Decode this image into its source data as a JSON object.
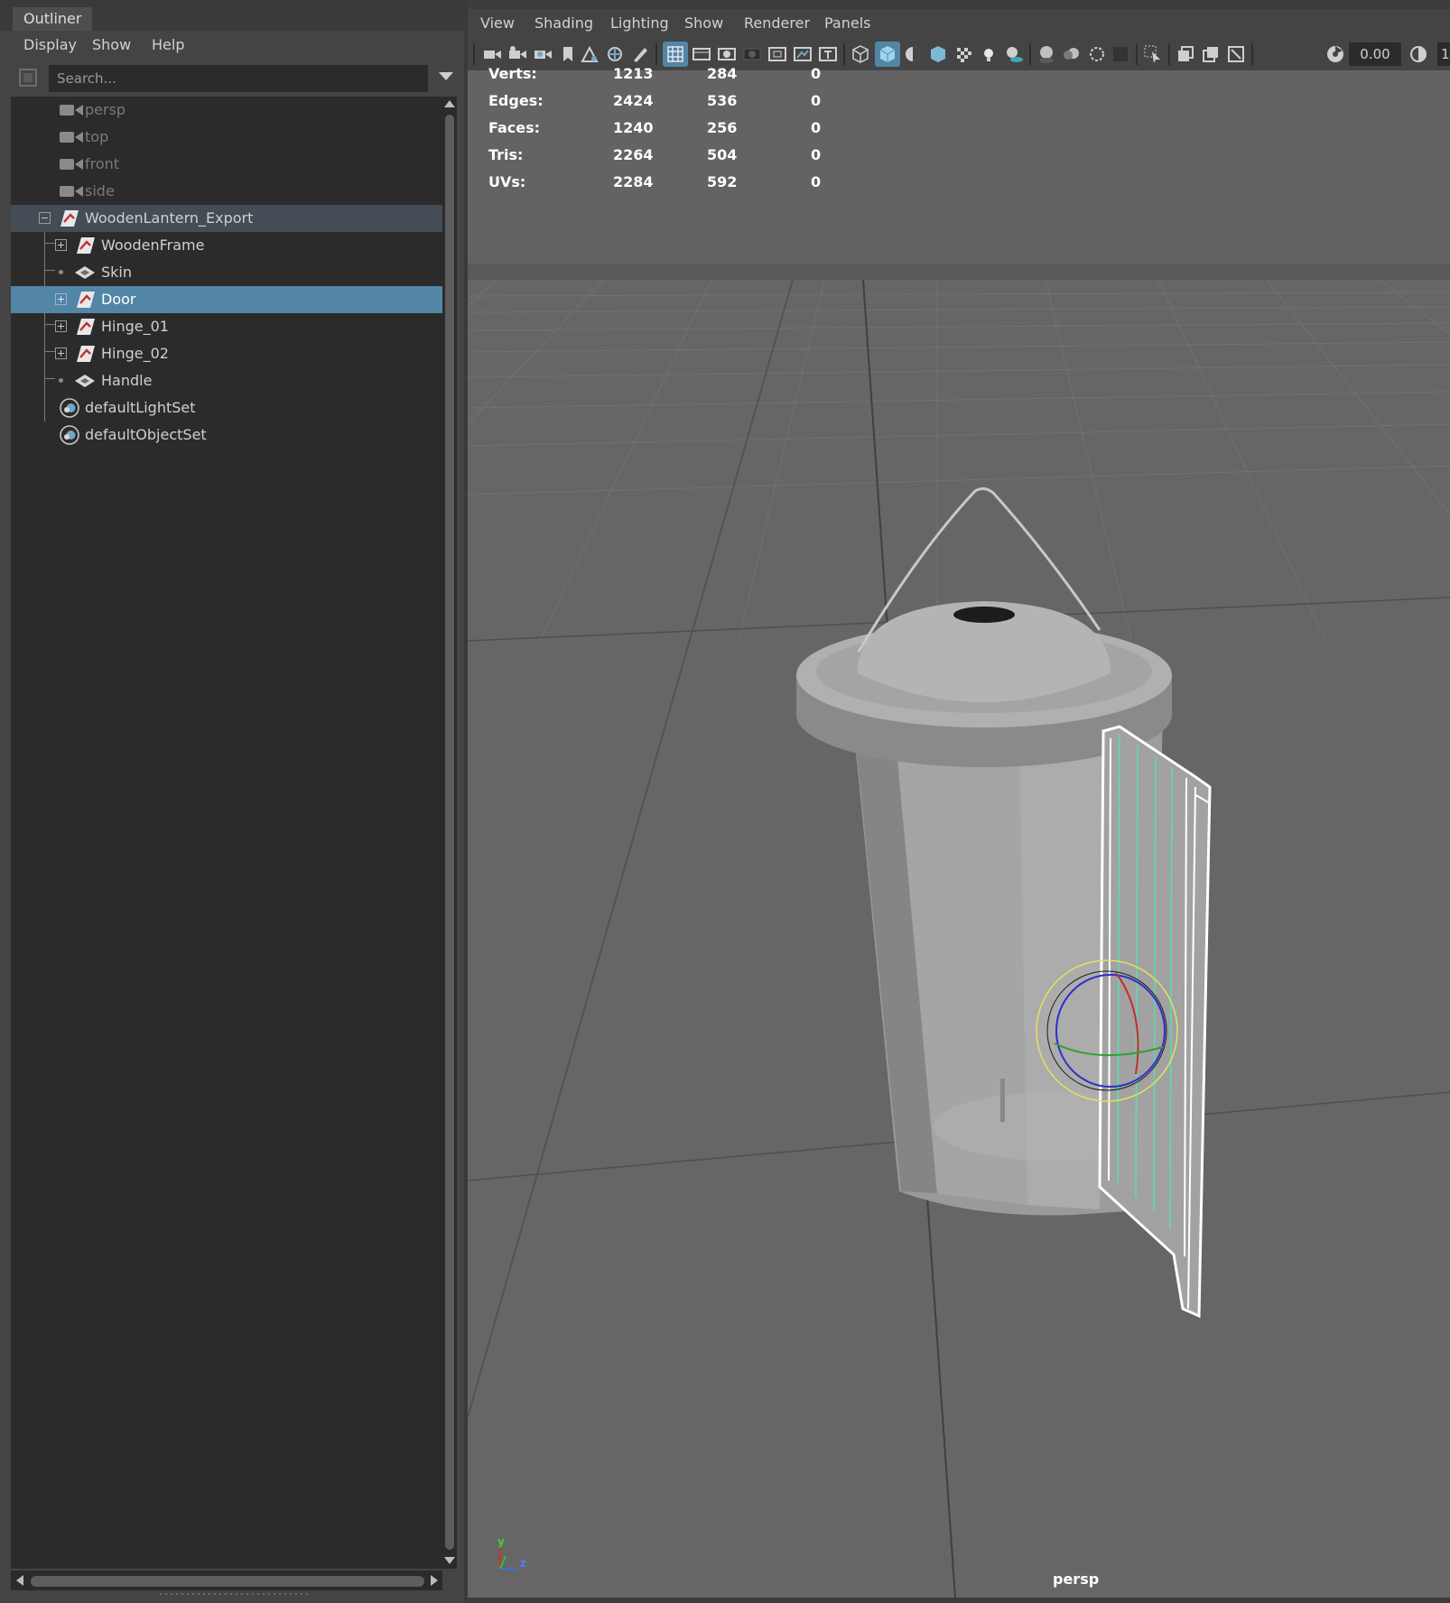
{
  "outliner": {
    "tab_label": "Outliner",
    "menu": [
      "Display",
      "Show",
      "Help"
    ],
    "search_placeholder": "Search...",
    "tree": [
      {
        "label": "persp",
        "type": "camera",
        "dim": true
      },
      {
        "label": "top",
        "type": "camera",
        "dim": true
      },
      {
        "label": "front",
        "type": "camera",
        "dim": true
      },
      {
        "label": "side",
        "type": "camera",
        "dim": true
      },
      {
        "label": "WoodenLantern_Export",
        "type": "transform",
        "expanded": true
      },
      {
        "label": "WoodenFrame",
        "type": "transform",
        "collapsed": true
      },
      {
        "label": "Skin",
        "type": "mesh"
      },
      {
        "label": "Door",
        "type": "transform",
        "collapsed": true,
        "selected": true
      },
      {
        "label": "Hinge_01",
        "type": "transform",
        "collapsed": true
      },
      {
        "label": "Hinge_02",
        "type": "transform",
        "collapsed": true
      },
      {
        "label": "Handle",
        "type": "mesh"
      },
      {
        "label": "defaultLightSet",
        "type": "set"
      },
      {
        "label": "defaultObjectSet",
        "type": "set"
      }
    ]
  },
  "viewport": {
    "menu": [
      "View",
      "Shading",
      "Lighting",
      "Show",
      "Renderer",
      "Panels"
    ],
    "exposure_value": "0.00",
    "gamma_value_partial": "1",
    "camera_name": "persp",
    "axis_labels": {
      "y": "y",
      "z": "z"
    },
    "hud": {
      "rows": [
        {
          "label": "Verts:",
          "values": [
            "1213",
            "284",
            "0"
          ]
        },
        {
          "label": "Edges:",
          "values": [
            "2424",
            "536",
            "0"
          ]
        },
        {
          "label": "Faces:",
          "values": [
            "1240",
            "256",
            "0"
          ]
        },
        {
          "label": "Tris:",
          "values": [
            "2264",
            "504",
            "0"
          ]
        },
        {
          "label": "UVs:",
          "values": [
            "2284",
            "592",
            "0"
          ]
        }
      ]
    },
    "toolbar_icons": [
      "select-camera-icon",
      "camera-attributes-icon",
      "bookmarks-icon",
      "image-plane-icon",
      "grid-icon",
      "film-gate-icon",
      "resolution-gate-icon",
      "gate-mask-icon",
      "field-chart-icon",
      "safe-action-icon",
      "safe-title-icon",
      "wireframe-icon",
      "smooth-shade-icon",
      "default-material-icon",
      "textured-icon",
      "shadows-icon",
      "use-lights-icon",
      "ambient-occlusion-icon",
      "isolate-select-icon",
      "xray-icon",
      "xray-joints-icon"
    ]
  },
  "colors": {
    "selection": "#5285a6",
    "panel": "#444444",
    "tree_bg": "#2b2b2b",
    "viewport_bg": "#656565",
    "wire_highlight": "#58e0b0",
    "manipulator_yellow": "#e6e060"
  }
}
